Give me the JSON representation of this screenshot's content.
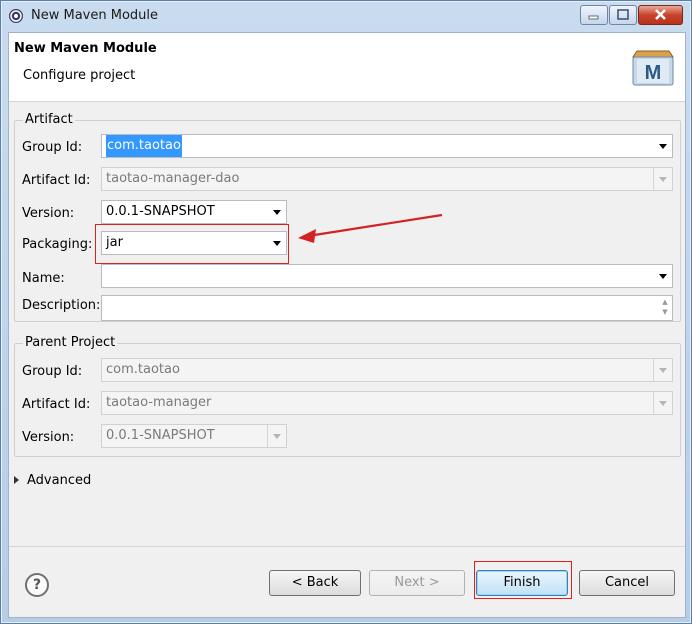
{
  "window": {
    "title": "New Maven Module"
  },
  "header": {
    "title": "New Maven Module",
    "subtitle": "Configure project",
    "logo_icon": "maven-logo-icon"
  },
  "artifact": {
    "group_label": "Artifact",
    "group_id": {
      "label": "Group Id:",
      "value": "com.taotao"
    },
    "artifact_id": {
      "label": "Artifact Id:",
      "value": "taotao-manager-dao"
    },
    "version": {
      "label": "Version:",
      "value": "0.0.1-SNAPSHOT"
    },
    "packaging": {
      "label": "Packaging:",
      "value": "jar"
    },
    "name": {
      "label": "Name:",
      "value": ""
    },
    "description": {
      "label": "Description:",
      "value": ""
    }
  },
  "parent": {
    "group_label": "Parent Project",
    "group_id": {
      "label": "Group Id:",
      "value": "com.taotao"
    },
    "artifact_id": {
      "label": "Artifact Id:",
      "value": "taotao-manager"
    },
    "version": {
      "label": "Version:",
      "value": "0.0.1-SNAPSHOT"
    }
  },
  "advanced": {
    "label": "Advanced"
  },
  "footer": {
    "help_symbol": "?",
    "back": "< Back",
    "next": "Next >",
    "finish": "Finish",
    "cancel": "Cancel"
  },
  "annotation": {
    "color": "#e02020"
  }
}
